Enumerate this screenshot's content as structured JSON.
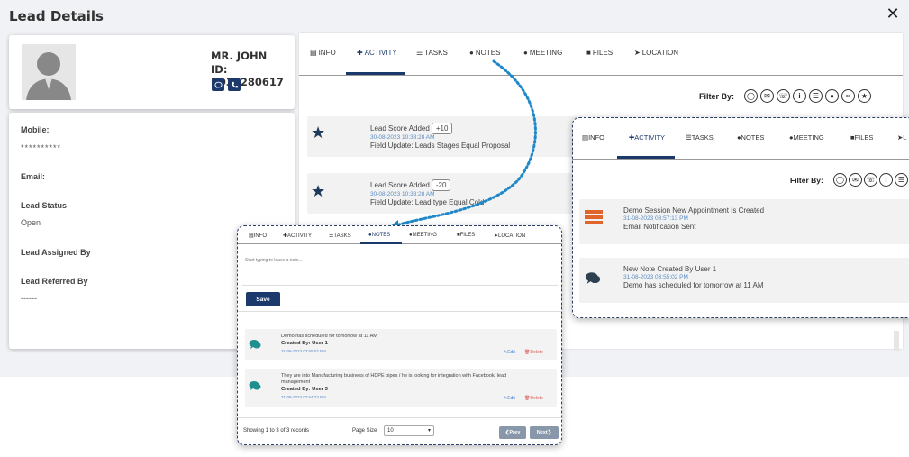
{
  "header": {
    "title": "Lead Details",
    "close_glyph": "✕"
  },
  "profile": {
    "name": "MR. JOHN",
    "id": "ID: LD31280617"
  },
  "lead_info": {
    "mobile_label": "Mobile:",
    "mobile_value": "**********",
    "email_label": "Email:",
    "email_value": "",
    "status_label": "Lead Status",
    "status_value": "Open",
    "assigned_label": "Lead Assigned By",
    "assigned_value": "",
    "referred_label": "Lead Referred By",
    "referred_value": "------"
  },
  "tabs": [
    {
      "label": "INFO",
      "icon": "▤"
    },
    {
      "label": "ACTIVITY",
      "icon": "✚"
    },
    {
      "label": "TASKS",
      "icon": "☰"
    },
    {
      "label": "NOTES",
      "icon": "●"
    },
    {
      "label": "MEETING",
      "icon": "●"
    },
    {
      "label": "FILES",
      "icon": "■"
    },
    {
      "label": "LOCATION",
      "icon": "➤"
    }
  ],
  "filter_label": "Filter By:",
  "activities": [
    {
      "title": "Lead Score Added",
      "score": "+10",
      "date": "30-08-2023 10:33:28 AM",
      "detail": "Field Update: Leads Stages Equal Proposal"
    },
    {
      "title": "Lead Score Added",
      "score": "-20",
      "date": "30-08-2023 10:33:28 AM",
      "detail": "Field Update: Lead type Equal Cold"
    }
  ],
  "notes_popup": {
    "placeholder": "Start typing to leave a note...",
    "save_label": "Save",
    "notes": [
      {
        "text": "Demo has scheduled for tomorrow at 11 AM",
        "by_label": "Created By:",
        "by_user": "User 1",
        "date": "31-08-2023 03:55:02 PM",
        "edit": "Edit",
        "delete": "Delete"
      },
      {
        "text": "They are into Manufacturing business of HDPE pipes  / he is looking for integration with Facebook/ lead",
        "text2": "management",
        "by_label": "Created By:",
        "by_user": "User 3",
        "date": "31-08-2023 03:54:23 PM",
        "edit": "Edit",
        "delete": "Delete"
      }
    ],
    "showing_text": "Showing 1 to 3 of 3 records",
    "page_size_label": "Page Size",
    "page_size_value": "10",
    "prev_label": "Prev",
    "next_label": "Next"
  },
  "activity_popup": {
    "filter_label": "Filter By:",
    "items": [
      {
        "title": "Demo Session New Appointment Is Created",
        "date": "31-08-2023 03:57:13 PM",
        "detail": "Email Notification Sent"
      },
      {
        "title": "New Note Created By User 1",
        "date": "31-08-2023 03:55:02 PM",
        "detail": "Demo has scheduled for tomorrow at 11 AM"
      }
    ]
  },
  "colors": {
    "primary": "#1b3a6b",
    "link": "#5b8cc4",
    "arrow": "#1e88c8",
    "edit": "#3b7dd8",
    "delete": "#d9534f"
  }
}
